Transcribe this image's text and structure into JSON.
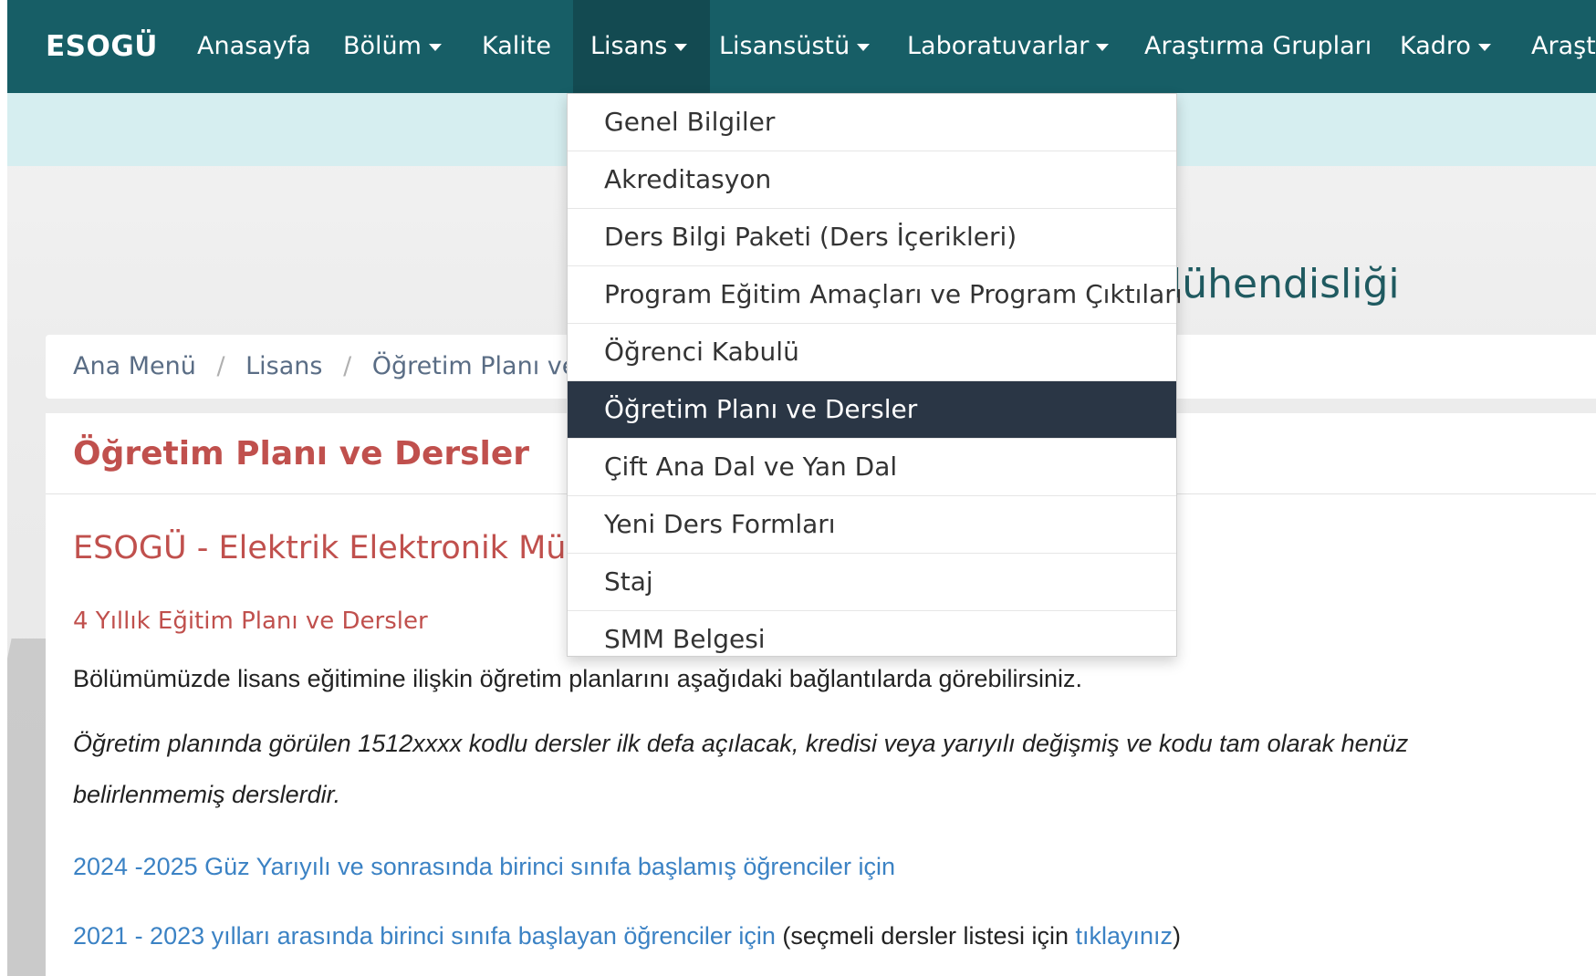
{
  "navbar": {
    "brand": "ESOGÜ",
    "items": [
      {
        "label": "Anasayfa"
      },
      {
        "label": "Bölüm"
      },
      {
        "label": "Kalite"
      },
      {
        "label": "Lisans"
      },
      {
        "label": "Lisansüstü"
      },
      {
        "label": "Laboratuvarlar"
      },
      {
        "label": "Araştırma Grupları"
      },
      {
        "label": "Kadro"
      },
      {
        "label": "Araşt"
      }
    ]
  },
  "dropdown": {
    "items": [
      {
        "label": "Genel Bilgiler"
      },
      {
        "label": "Akreditasyon"
      },
      {
        "label": "Ders Bilgi Paketi (Ders İçerikleri)"
      },
      {
        "label": "Program Eğitim Amaçları ve Program Çıktıları"
      },
      {
        "label": "Öğrenci Kabulü"
      },
      {
        "label": "Öğretim Planı ve Dersler"
      },
      {
        "label": "Çift Ana Dal ve Yan Dal"
      },
      {
        "label": "Yeni Ders Formları"
      },
      {
        "label": "Staj"
      },
      {
        "label": "SMM Belgesi"
      }
    ]
  },
  "header": {
    "dept_title_visible": "lühendisliği"
  },
  "breadcrumb": {
    "items": [
      "Ana Menü",
      "Lisans",
      "Öğretim Planı ve D"
    ]
  },
  "content": {
    "title": "Öğretim Planı ve Dersler",
    "subheading": "ESOGÜ - Elektrik Elektronik Mühe",
    "small_heading": "4 Yıllık Eğitim Planı ve Dersler",
    "paragraph1": "Bölümümüzde lisans eğitimine ilişkin öğretim planlarını aşağıdaki bağlantılarda görebilirsiniz.",
    "paragraph2_line1": "Öğretim planında görülen 1512xxxx kodlu dersler ilk defa açılacak, kredisi veya yarıyılı değişmiş ve kodu tam olarak henüz",
    "paragraph2_line2": "belirlenmemiş derslerdir.",
    "link1": "2024 -2025 Güz Yarıyılı ve sonrasında birinci sınıfa başlamış öğrenciler için",
    "link2": "2021 - 2023 yılları arasında birinci sınıfa başlayan öğrenciler için",
    "link2_suffix_start": " (seçmeli dersler listesi için ",
    "link2_suffix_link": "tıklayınız",
    "link2_suffix_end": ")"
  },
  "colors": {
    "navbar": "#175e66",
    "accent_red": "#c0504d",
    "link_blue": "#3b82c4",
    "dropdown_active": "#2a3645"
  }
}
